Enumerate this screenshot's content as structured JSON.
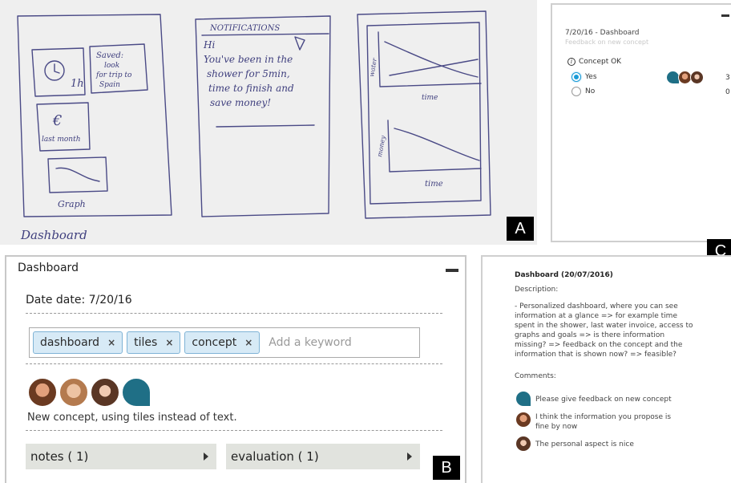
{
  "panel_labels": {
    "a": "A",
    "b": "B",
    "c": "C"
  },
  "sketch": {
    "saved_note": [
      "Saved:",
      "look",
      "for trip to",
      "Spain"
    ],
    "clock_caption": "1h",
    "money_caption": "last month",
    "graph_caption": "Graph",
    "notifications_title": "NOTIFICATIONS",
    "notification_text": [
      "Hi",
      "You've been in the",
      "shower for 5min,",
      "time to finish and",
      "save money!"
    ],
    "axis_y_top": "water",
    "axis_x_top": "time",
    "axis_y_bottom": "money",
    "axis_x_bottom": "time",
    "footer": "Dashboard"
  },
  "poll": {
    "title": "7/20/16 - Dashboard",
    "subtitle": "Feedback on new concept",
    "question": "Concept OK",
    "options": [
      {
        "label": "Yes",
        "selected": true,
        "count": "3"
      },
      {
        "label": "No",
        "selected": false,
        "count": "0"
      }
    ]
  },
  "card": {
    "title": "Dashboard",
    "date_line": "Date date: 7/20/16",
    "keywords": [
      "dashboard",
      "tiles",
      "concept"
    ],
    "keyword_remove_glyph": "×",
    "keyword_placeholder": "Add a keyword",
    "description": "New concept, using tiles instead of text.",
    "notes_label": "notes ( 1)",
    "evaluation_label": "evaluation ( 1)"
  },
  "detail": {
    "title": "Dashboard (20/07/2016)",
    "description_label": "Description:",
    "description_lines": [
      "- Personalized dashboard, where you can see",
      "information at a glance => for example time",
      "spent in the shower, last water invoice, access to",
      "graphs and goals => is there information",
      "missing? => feedback on the concept and the",
      "information that is shown now? => feasible?"
    ],
    "comments_label": "Comments:",
    "comments": [
      {
        "avatar": "blue-avatar",
        "lines": [
          "Please give feedback on new concept"
        ]
      },
      {
        "avatar": "male-avatar",
        "lines": [
          "I think the information you propose is",
          "fine by now"
        ]
      },
      {
        "avatar": "female-avatar",
        "lines": [
          "The personal aspect is nice"
        ]
      }
    ]
  }
}
